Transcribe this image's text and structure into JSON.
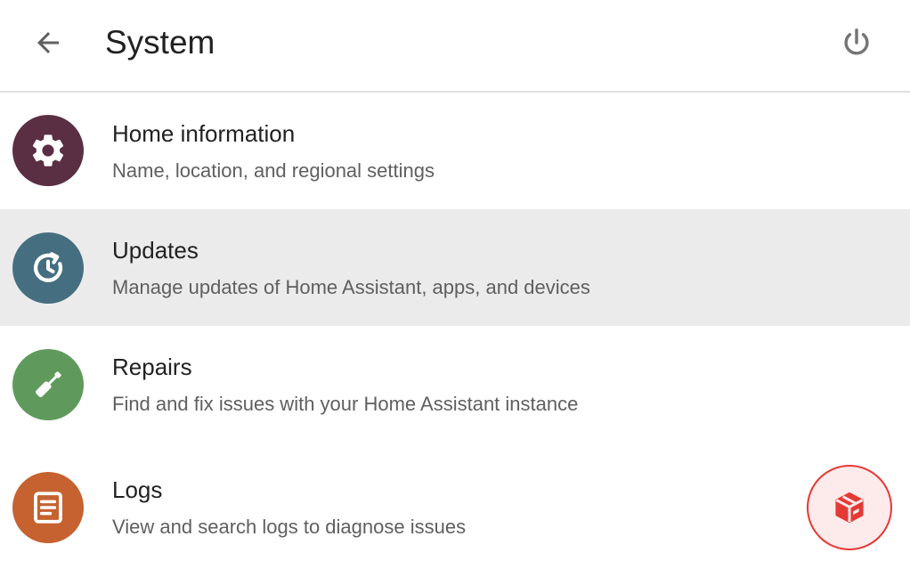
{
  "header": {
    "title": "System",
    "back_icon": "arrow-left-icon",
    "power_icon": "power-icon"
  },
  "items": [
    {
      "title": "Home information",
      "subtitle": "Name, location, and regional settings",
      "icon": "gear-icon",
      "color": "#5a2e43",
      "selected": false
    },
    {
      "title": "Updates",
      "subtitle": "Manage updates of Home Assistant, apps, and devices",
      "icon": "update-clock-icon",
      "color": "#456f80",
      "selected": true
    },
    {
      "title": "Repairs",
      "subtitle": "Find and fix issues with your Home Assistant instance",
      "icon": "screwdriver-icon",
      "color": "#5f9a5c",
      "selected": false
    },
    {
      "title": "Logs",
      "subtitle": "View and search logs to diagnose issues",
      "icon": "log-document-icon",
      "color": "#c5622f",
      "selected": false
    }
  ],
  "fab": {
    "icon": "package-icon",
    "color": "#e53935"
  }
}
